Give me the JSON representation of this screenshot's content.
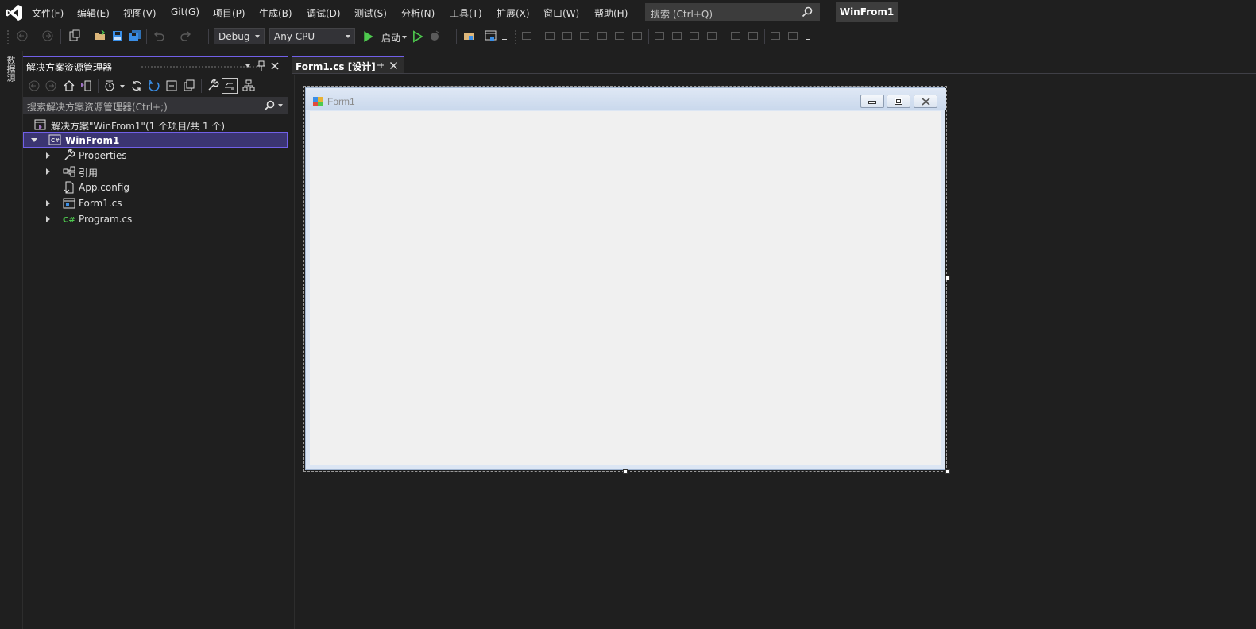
{
  "menu": {
    "items": [
      "文件(F)",
      "编辑(E)",
      "视图(V)",
      "Git(G)",
      "项目(P)",
      "生成(B)",
      "调试(D)",
      "测试(S)",
      "分析(N)",
      "工具(T)",
      "扩展(X)",
      "窗口(W)",
      "帮助(H)"
    ],
    "search_placeholder": "搜索 (Ctrl+Q)",
    "solution_name": "WinFrom1"
  },
  "toolbar": {
    "configuration": "Debug",
    "platform": "Any CPU",
    "run_label": "启动"
  },
  "left_strip": {
    "label": "数据源"
  },
  "solution_explorer": {
    "title": "解决方案资源管理器",
    "search_placeholder": "搜索解决方案资源管理器(Ctrl+;)",
    "solution_label": "解决方案\"WinFrom1\"(1 个项目/共 1 个)",
    "project_label": "WinFrom1",
    "items": [
      {
        "label": "Properties",
        "icon": "wrench-icon",
        "expandable": true
      },
      {
        "label": "引用",
        "icon": "references-icon",
        "expandable": true
      },
      {
        "label": "App.config",
        "icon": "config-file-icon",
        "expandable": false
      },
      {
        "label": "Form1.cs",
        "icon": "form-icon",
        "expandable": true
      },
      {
        "label": "Program.cs",
        "icon": "csharp-file-icon",
        "expandable": true
      }
    ]
  },
  "document": {
    "tab_label": "Form1.cs [设计]",
    "form_title": "Form1"
  },
  "colors": {
    "accent": "#7160e8",
    "background": "#1f1f1f",
    "form_client": "#f0f0f0",
    "run_green": "#4ec94e"
  }
}
